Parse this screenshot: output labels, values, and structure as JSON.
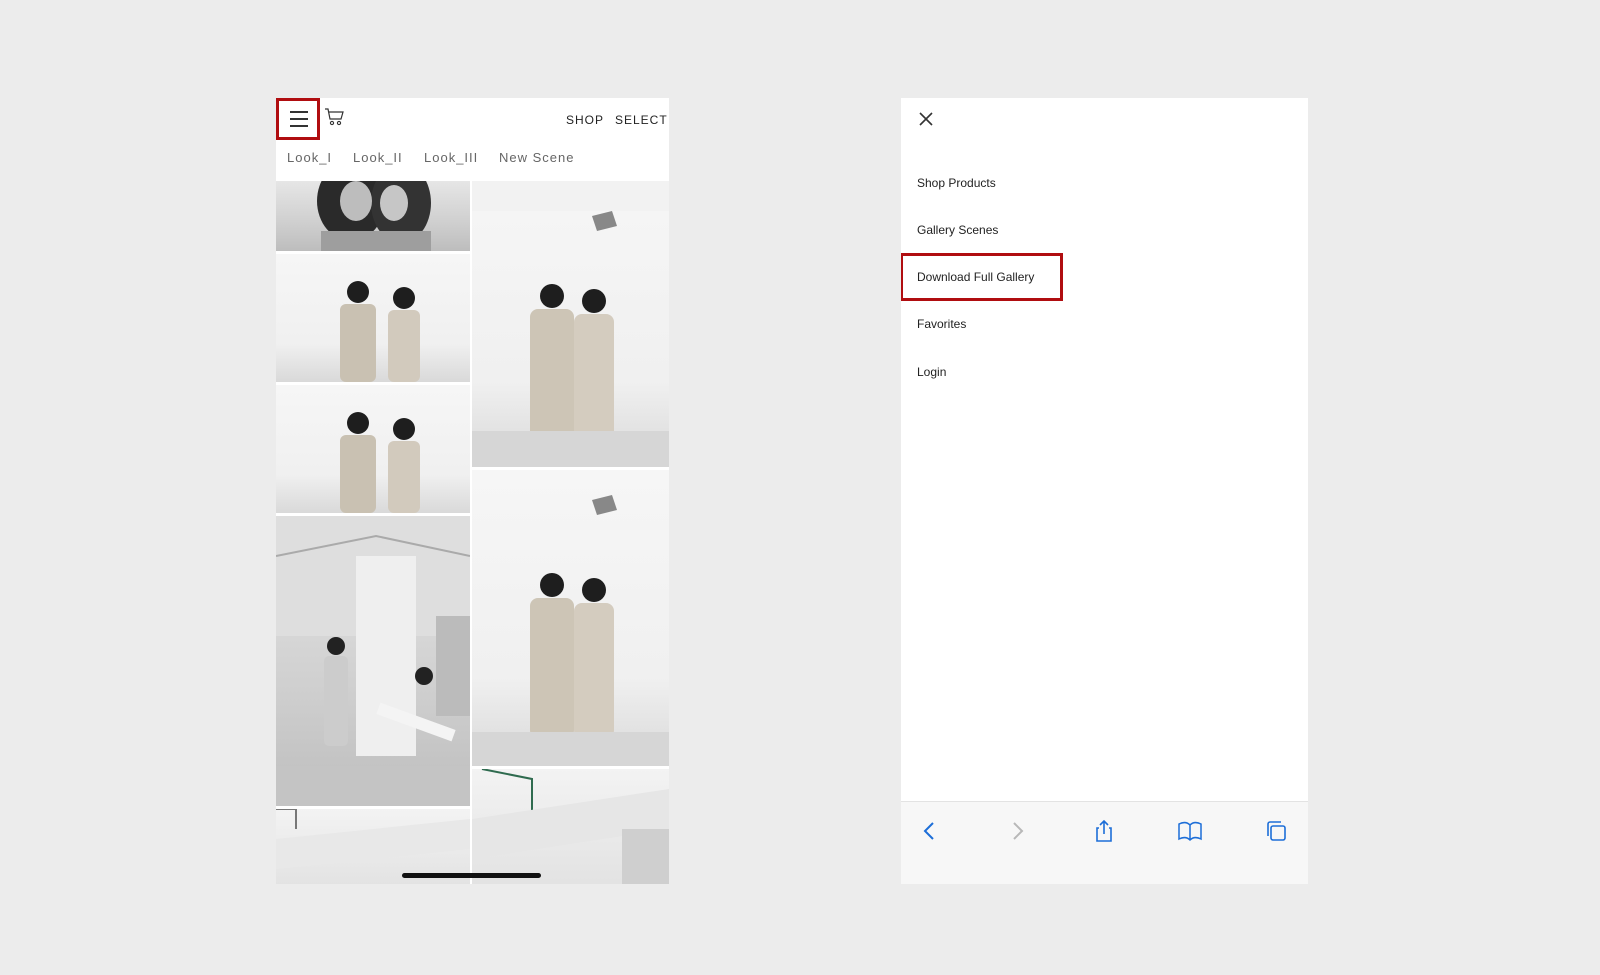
{
  "left_screen": {
    "header": {
      "shop_label": "SHOP",
      "select_label": "SELECT"
    },
    "tabs": [
      "Look_I",
      "Look_II",
      "Look_III",
      "New Scene"
    ]
  },
  "right_screen": {
    "menu_items": [
      "Shop Products",
      "Gallery Scenes",
      "Download Full Gallery",
      "Favorites",
      "Login"
    ]
  },
  "colors": {
    "highlight": "#b00d10",
    "ios_blue": "#1d6ed8",
    "page_bg": "#ececec"
  },
  "icons": [
    "hamburger-icon",
    "cart-icon",
    "close-icon",
    "back-icon",
    "forward-icon",
    "share-icon",
    "bookmarks-icon",
    "tabs-icon"
  ]
}
